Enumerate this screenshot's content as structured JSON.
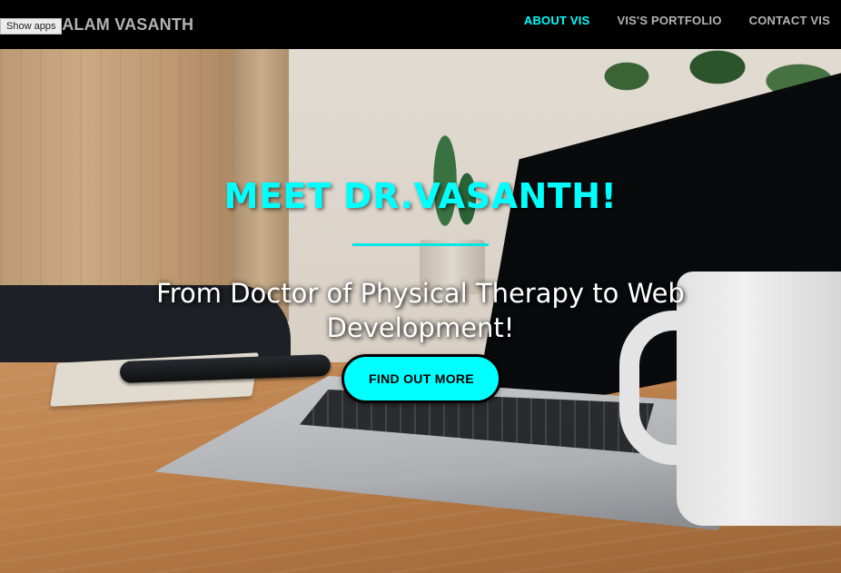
{
  "tooltip": {
    "text": "Show apps"
  },
  "navbar": {
    "brand": "SALAM VASANTH",
    "links": [
      {
        "label": "ABOUT VIS",
        "active": true
      },
      {
        "label": "VIS'S PORTFOLIO",
        "active": false
      },
      {
        "label": "CONTACT VIS",
        "active": false
      }
    ]
  },
  "hero": {
    "title": "MEET DR.VASANTH!",
    "subtitle": "From Doctor of Physical Therapy to Web Development!",
    "cta_label": "FIND OUT MORE"
  },
  "colors": {
    "accent": "#00ffff",
    "nav_text": "#b3b3b3",
    "nav_background": "#000000"
  }
}
